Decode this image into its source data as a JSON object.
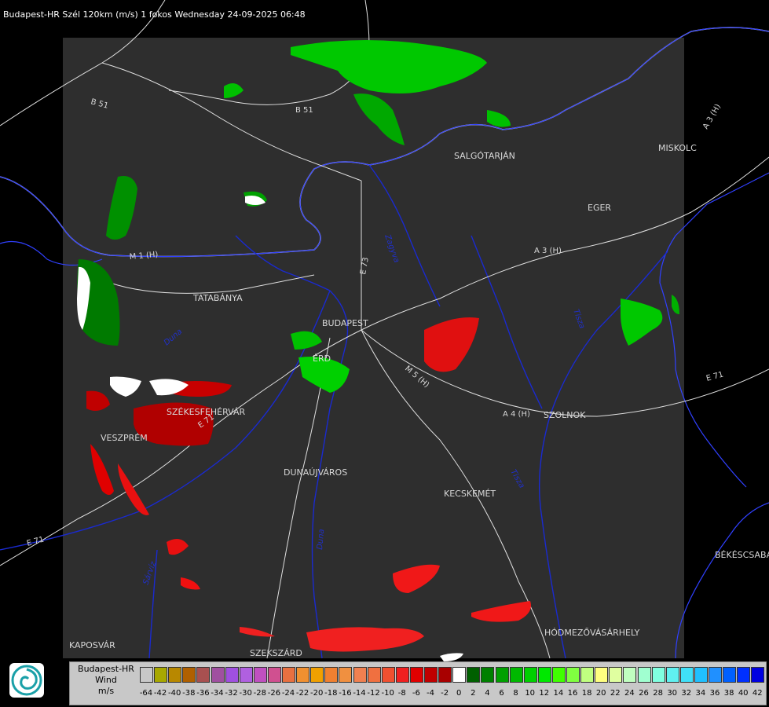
{
  "title": "Budapest-HR Szél 120km (m/s) 1 fokos Wednesday 24-09-2025 06:48",
  "cities": [
    "SALGÓTARJÁN",
    "MISKOLC",
    "EGER",
    "TATABÁNYA",
    "BUDAPEST",
    "ÉRD",
    "SZÉKESFEHÉRVÁR",
    "VESZPRÉM",
    "DUNAÚJVÁROS",
    "KECSKEMÉT",
    "BÉKÉSCSABA",
    "HÓDMEZŐVÁSÁRHELY",
    "KAPOSVÁR",
    "SZEKSZÁRD",
    "SZOLNOK"
  ],
  "roads": [
    "B 51",
    "B 51",
    "A 3 (H)",
    "A 3 (H)",
    "M 1 (H)",
    "E 71",
    "A 4 (H)",
    "E 71",
    "E 71",
    "E 73",
    "M 5 (H)"
  ],
  "rivers": [
    "Duna",
    "Tisza",
    "Sárvíz",
    "Zagyva",
    "Tisza",
    "Duna"
  ],
  "legend": {
    "name_lines": [
      "Budapest-HR",
      "Wind",
      "m/s"
    ],
    "ticks": [
      "-64",
      "-42",
      "-40",
      "-38",
      "-36",
      "-34",
      "-32",
      "-30",
      "-28",
      "-26",
      "-24",
      "-22",
      "-20",
      "-18",
      "-16",
      "-14",
      "-12",
      "-10",
      "-8",
      "-6",
      "-4",
      "-2",
      "0",
      "2",
      "4",
      "6",
      "8",
      "10",
      "12",
      "14",
      "16",
      "18",
      "20",
      "22",
      "24",
      "26",
      "28",
      "30",
      "32",
      "34",
      "36",
      "38",
      "40",
      "42"
    ],
    "colors": [
      "#c8c8c8",
      "#a8a800",
      "#b88800",
      "#b06000",
      "#a85050",
      "#a050a0",
      "#a050e0",
      "#b060e0",
      "#c050c0",
      "#d05090",
      "#e87040",
      "#f09030",
      "#f0a000",
      "#f08030",
      "#f09040",
      "#f08050",
      "#f07040",
      "#f05030",
      "#f02020",
      "#e00000",
      "#c00000",
      "#a80000",
      "#ffffff",
      "#006000",
      "#008000",
      "#00a000",
      "#00b800",
      "#00d000",
      "#00e800",
      "#40ff00",
      "#80ff40",
      "#c0ff80",
      "#ffff80",
      "#e0ffa0",
      "#c0ffc0",
      "#a0ffd0",
      "#80ffe0",
      "#60f0f0",
      "#40e0f8",
      "#20c0ff",
      "#2090ff",
      "#0060ff",
      "#0030ff",
      "#0000e0"
    ]
  }
}
